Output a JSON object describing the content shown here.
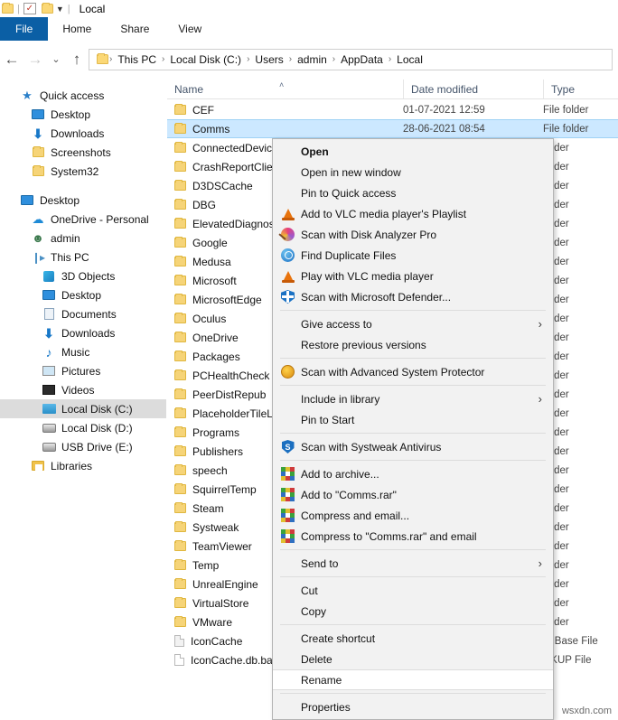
{
  "window": {
    "title": "Local",
    "quick_access_toolbar": [
      "folder-icon",
      "properties-icon",
      "new-folder-icon",
      "customize-caret"
    ]
  },
  "ribbon": {
    "tabs": [
      {
        "label": "File",
        "active_style": "file"
      },
      {
        "label": "Home",
        "active_style": "normal"
      },
      {
        "label": "Share",
        "active_style": "normal"
      },
      {
        "label": "View",
        "active_style": "normal"
      }
    ]
  },
  "address_bar": {
    "back_icon": "←",
    "forward_icon": "→",
    "recent_icon": "⌄",
    "up_icon": "↑",
    "separator": "›",
    "crumbs": [
      "This PC",
      "Local Disk (C:)",
      "Users",
      "admin",
      "AppData",
      "Local"
    ]
  },
  "columns": {
    "name": "Name",
    "date_modified": "Date modified",
    "type": "Type",
    "sort_caret": "˄"
  },
  "sidebar": {
    "items": [
      {
        "label": "Quick access",
        "icon": "pin-icon",
        "indent": 0,
        "selected": false
      },
      {
        "label": "Desktop",
        "icon": "monitor-icon",
        "indent": 1,
        "selected": false
      },
      {
        "label": "Downloads",
        "icon": "download-icon",
        "indent": 1,
        "selected": false
      },
      {
        "label": "Screenshots",
        "icon": "folder-icon",
        "indent": 1,
        "selected": false
      },
      {
        "label": "System32",
        "icon": "folder-icon",
        "indent": 1,
        "selected": false
      },
      {
        "label": "Desktop",
        "icon": "monitor-icon",
        "indent": 0,
        "selected": false,
        "gap_before": true
      },
      {
        "label": "OneDrive - Personal",
        "icon": "cloud-icon",
        "indent": 1,
        "selected": false
      },
      {
        "label": "admin",
        "icon": "user-icon",
        "indent": 1,
        "selected": false
      },
      {
        "label": "This PC",
        "icon": "pc-icon",
        "indent": 1,
        "selected": false
      },
      {
        "label": "3D Objects",
        "icon": "cube-icon",
        "indent": 2,
        "selected": false
      },
      {
        "label": "Desktop",
        "icon": "monitor-icon",
        "indent": 2,
        "selected": false
      },
      {
        "label": "Documents",
        "icon": "document-icon",
        "indent": 2,
        "selected": false
      },
      {
        "label": "Downloads",
        "icon": "download-icon",
        "indent": 2,
        "selected": false
      },
      {
        "label": "Music",
        "icon": "music-icon",
        "indent": 2,
        "selected": false
      },
      {
        "label": "Pictures",
        "icon": "picture-icon",
        "indent": 2,
        "selected": false
      },
      {
        "label": "Videos",
        "icon": "video-icon",
        "indent": 2,
        "selected": false
      },
      {
        "label": "Local Disk (C:)",
        "icon": "disk-c-icon",
        "indent": 2,
        "selected": true
      },
      {
        "label": "Local Disk (D:)",
        "icon": "disk-icon",
        "indent": 2,
        "selected": false
      },
      {
        "label": "USB Drive (E:)",
        "icon": "usb-drive-icon",
        "indent": 2,
        "selected": false
      },
      {
        "label": "Libraries",
        "icon": "libraries-icon",
        "indent": 1,
        "selected": false
      }
    ]
  },
  "file_list": {
    "rows": [
      {
        "name": "CEF",
        "icon": "folder-icon",
        "date": "01-07-2021 12:59",
        "type": "File folder",
        "selected": false
      },
      {
        "name": "Comms",
        "icon": "folder-icon",
        "date": "28-06-2021 08:54",
        "type": "File folder",
        "selected": true
      },
      {
        "name": "ConnectedDevice",
        "icon": "folder-icon",
        "date": "",
        "type": "folder",
        "selected": false
      },
      {
        "name": "CrashReportClie",
        "icon": "folder-icon",
        "date": "",
        "type": "folder",
        "selected": false
      },
      {
        "name": "D3DSCache",
        "icon": "folder-icon",
        "date": "",
        "type": "folder",
        "selected": false
      },
      {
        "name": "DBG",
        "icon": "folder-icon",
        "date": "",
        "type": "folder",
        "selected": false
      },
      {
        "name": "ElevatedDiagnos",
        "icon": "folder-icon",
        "date": "",
        "type": "folder",
        "selected": false
      },
      {
        "name": "Google",
        "icon": "folder-icon",
        "date": "",
        "type": "folder",
        "selected": false
      },
      {
        "name": "Medusa",
        "icon": "folder-icon",
        "date": "",
        "type": "folder",
        "selected": false
      },
      {
        "name": "Microsoft",
        "icon": "folder-icon",
        "date": "",
        "type": "folder",
        "selected": false
      },
      {
        "name": "MicrosoftEdge",
        "icon": "folder-icon",
        "date": "",
        "type": "folder",
        "selected": false
      },
      {
        "name": "Oculus",
        "icon": "folder-icon",
        "date": "",
        "type": "folder",
        "selected": false
      },
      {
        "name": "OneDrive",
        "icon": "folder-icon",
        "date": "",
        "type": "folder",
        "selected": false
      },
      {
        "name": "Packages",
        "icon": "folder-icon",
        "date": "",
        "type": "folder",
        "selected": false
      },
      {
        "name": "PCHealthCheck",
        "icon": "folder-icon",
        "date": "",
        "type": "folder",
        "selected": false
      },
      {
        "name": "PeerDistRepub",
        "icon": "folder-icon",
        "date": "",
        "type": "folder",
        "selected": false
      },
      {
        "name": "PlaceholderTileL",
        "icon": "folder-icon",
        "date": "",
        "type": "folder",
        "selected": false
      },
      {
        "name": "Programs",
        "icon": "folder-icon",
        "date": "",
        "type": "folder",
        "selected": false
      },
      {
        "name": "Publishers",
        "icon": "folder-icon",
        "date": "",
        "type": "folder",
        "selected": false
      },
      {
        "name": "speech",
        "icon": "folder-icon",
        "date": "",
        "type": "folder",
        "selected": false
      },
      {
        "name": "SquirrelTemp",
        "icon": "folder-icon",
        "date": "",
        "type": "folder",
        "selected": false
      },
      {
        "name": "Steam",
        "icon": "folder-icon",
        "date": "",
        "type": "folder",
        "selected": false
      },
      {
        "name": "Systweak",
        "icon": "folder-icon",
        "date": "",
        "type": "folder",
        "selected": false
      },
      {
        "name": "TeamViewer",
        "icon": "folder-icon",
        "date": "",
        "type": "folder",
        "selected": false
      },
      {
        "name": "Temp",
        "icon": "folder-icon",
        "date": "",
        "type": "folder",
        "selected": false
      },
      {
        "name": "UnrealEngine",
        "icon": "folder-icon",
        "date": "",
        "type": "folder",
        "selected": false
      },
      {
        "name": "VirtualStore",
        "icon": "folder-icon",
        "date": "",
        "type": "folder",
        "selected": false
      },
      {
        "name": "VMware",
        "icon": "folder-icon",
        "date": "",
        "type": "folder",
        "selected": false
      },
      {
        "name": "IconCache",
        "icon": "file-shaded-icon",
        "date": "",
        "type": "ta Base File",
        "selected": false
      },
      {
        "name": "IconCache.db.ba",
        "icon": "file-icon",
        "date": "",
        "type": "CKUP File",
        "selected": false
      }
    ]
  },
  "context_menu": {
    "items": [
      {
        "label": "Open",
        "icon": "",
        "bold": true,
        "highlight": false,
        "submenu": false
      },
      {
        "label": "Open in new window",
        "icon": "",
        "bold": false,
        "highlight": false,
        "submenu": false
      },
      {
        "label": "Pin to Quick access",
        "icon": "",
        "bold": false,
        "highlight": false,
        "submenu": false
      },
      {
        "label": "Add to VLC media player's Playlist",
        "icon": "vlc-icon",
        "bold": false,
        "highlight": false,
        "submenu": false
      },
      {
        "label": "Scan with Disk Analyzer Pro",
        "icon": "disk-analyzer-icon",
        "bold": false,
        "highlight": false,
        "submenu": false
      },
      {
        "label": " Find Duplicate Files",
        "icon": "find-duplicate-icon",
        "bold": false,
        "highlight": false,
        "submenu": false
      },
      {
        "label": "Play with VLC media player",
        "icon": "vlc-icon",
        "bold": false,
        "highlight": false,
        "submenu": false
      },
      {
        "label": "Scan with Microsoft Defender...",
        "icon": "defender-icon",
        "bold": false,
        "highlight": false,
        "submenu": false
      },
      {
        "separator": true
      },
      {
        "label": "Give access to",
        "icon": "",
        "bold": false,
        "highlight": false,
        "submenu": true
      },
      {
        "label": "Restore previous versions",
        "icon": "",
        "bold": false,
        "highlight": false,
        "submenu": false
      },
      {
        "separator": true
      },
      {
        "label": "Scan with Advanced System Protector",
        "icon": "advanced-system-protector-icon",
        "bold": false,
        "highlight": false,
        "submenu": false
      },
      {
        "separator": true
      },
      {
        "label": "Include in library",
        "icon": "",
        "bold": false,
        "highlight": false,
        "submenu": true
      },
      {
        "label": "Pin to Start",
        "icon": "",
        "bold": false,
        "highlight": false,
        "submenu": false
      },
      {
        "separator": true
      },
      {
        "label": "Scan with Systweak Antivirus",
        "icon": "systweak-icon",
        "bold": false,
        "highlight": false,
        "submenu": false
      },
      {
        "separator": true
      },
      {
        "label": "Add to archive...",
        "icon": "winrar-icon",
        "bold": false,
        "highlight": false,
        "submenu": false
      },
      {
        "label": "Add to \"Comms.rar\"",
        "icon": "winrar-icon",
        "bold": false,
        "highlight": false,
        "submenu": false
      },
      {
        "label": "Compress and email...",
        "icon": "winrar-icon",
        "bold": false,
        "highlight": false,
        "submenu": false
      },
      {
        "label": "Compress to \"Comms.rar\" and email",
        "icon": "winrar-icon",
        "bold": false,
        "highlight": false,
        "submenu": false
      },
      {
        "separator": true
      },
      {
        "label": "Send to",
        "icon": "",
        "bold": false,
        "highlight": false,
        "submenu": true
      },
      {
        "separator": true
      },
      {
        "label": "Cut",
        "icon": "",
        "bold": false,
        "highlight": false,
        "submenu": false
      },
      {
        "label": "Copy",
        "icon": "",
        "bold": false,
        "highlight": false,
        "submenu": false
      },
      {
        "separator": true
      },
      {
        "label": "Create shortcut",
        "icon": "",
        "bold": false,
        "highlight": false,
        "submenu": false
      },
      {
        "label": "Delete",
        "icon": "",
        "bold": false,
        "highlight": false,
        "submenu": false
      },
      {
        "label": "Rename",
        "icon": "",
        "bold": false,
        "highlight": true,
        "submenu": false
      },
      {
        "separator": true
      },
      {
        "label": "Properties",
        "icon": "",
        "bold": false,
        "highlight": false,
        "submenu": false
      }
    ],
    "submenu_arrow": "›"
  },
  "watermark": {
    "text": "wsxdn.com"
  },
  "colors": {
    "file_tab_blue": "#0b5fa5",
    "selection_blue": "#cce8ff",
    "menu_bg": "#f2f2f2",
    "header_text": "#44546a"
  }
}
